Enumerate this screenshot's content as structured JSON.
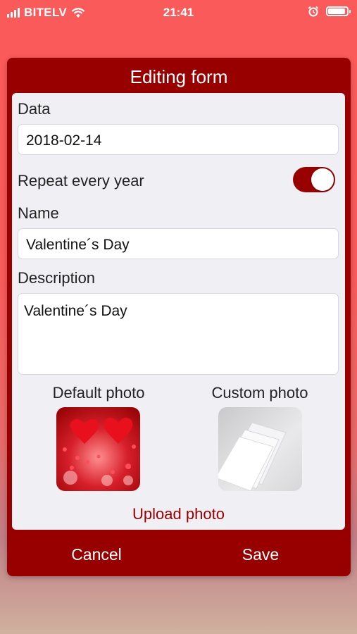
{
  "status_bar": {
    "carrier": "BITELV",
    "time": "21:41",
    "icons": [
      "signal-icon",
      "wifi-icon",
      "alarm-icon",
      "battery-icon"
    ]
  },
  "dialog": {
    "title": "Editing form",
    "fields": {
      "data_label": "Data",
      "data_value": "2018-02-14",
      "repeat_label": "Repeat every year",
      "repeat_on": true,
      "name_label": "Name",
      "name_value": "Valentine´s Day",
      "description_label": "Description",
      "description_value": "Valentine´s Day"
    },
    "photos": {
      "default_label": "Default photo",
      "custom_label": "Custom photo",
      "upload_label": "Upload photo"
    },
    "buttons": {
      "cancel": "Cancel",
      "save": "Save"
    }
  },
  "colors": {
    "accent": "#980000",
    "background": "#fb5a5a",
    "panel": "#f0eff4"
  }
}
